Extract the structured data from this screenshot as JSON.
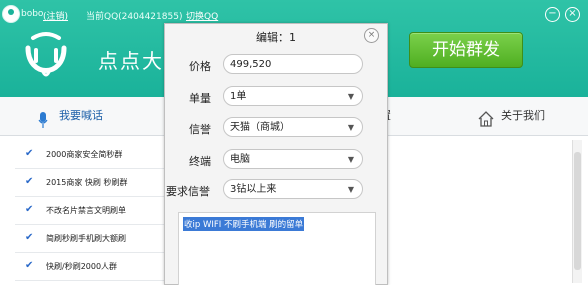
{
  "topbar": {
    "user": "bobo",
    "login": "(注销)",
    "qq_label": "当前QQ(2404421855)",
    "switch": "切换QQ",
    "minimize": "−",
    "close": "×"
  },
  "app": {
    "name": "点点大",
    "start_button": "开始群发"
  },
  "nav": {
    "items": [
      {
        "label": "我要喊话",
        "icon": "microphone-icon"
      },
      {
        "label": "置"
      },
      {
        "label": "关于我们",
        "icon": "home-icon"
      }
    ]
  },
  "list": {
    "items": [
      {
        "label": "2000商家安全简秒群",
        "checked": true
      },
      {
        "label": "2015商家 快刷 秒刷群",
        "checked": true
      },
      {
        "label": "不改名片禁言文明刷单",
        "checked": true
      },
      {
        "label": "简刷秒刷手机刷大额刷",
        "checked": true
      },
      {
        "label": "快刷/秒刷2000人群",
        "checked": true
      }
    ]
  },
  "dialog": {
    "title": "编辑：1",
    "close": "×",
    "fields": {
      "price": {
        "label": "价格",
        "value": "499,520"
      },
      "quantity": {
        "label": "单量",
        "value": "1单"
      },
      "reputation": {
        "label": "信誉",
        "value": "天猫（商城）"
      },
      "terminal": {
        "label": "终端",
        "value": "电脑"
      },
      "requirement": {
        "label": "要求信誉",
        "value": "3钻以上来"
      }
    },
    "text": "收ip WIFI 不刷手机端 刷的留单"
  },
  "colors": {
    "header_green": "#1ab29a",
    "start_button": "#4fae21",
    "selection_blue": "#3b7ad6"
  }
}
